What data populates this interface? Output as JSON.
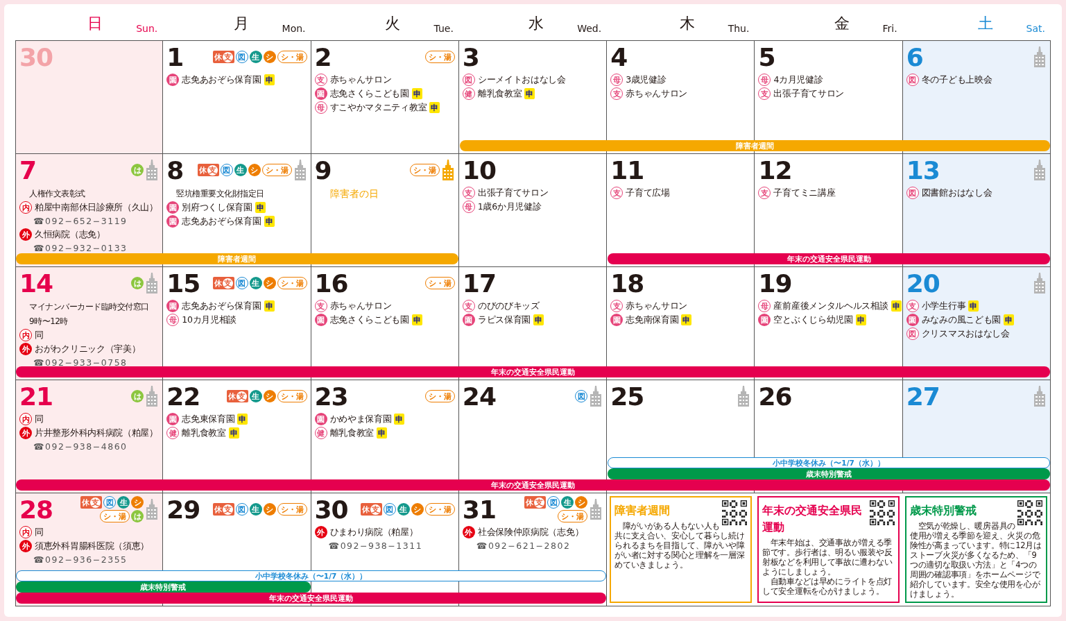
{
  "header": [
    {
      "kanji": "日",
      "en": "Sun.",
      "kind": "sun"
    },
    {
      "kanji": "月",
      "en": "Mon.",
      "kind": "weekday"
    },
    {
      "kanji": "火",
      "en": "Tue.",
      "kind": "weekday"
    },
    {
      "kanji": "水",
      "en": "Wed.",
      "kind": "weekday"
    },
    {
      "kanji": "木",
      "en": "Thu.",
      "kind": "weekday"
    },
    {
      "kanji": "金",
      "en": "Fri.",
      "kind": "weekday"
    },
    {
      "kanji": "土",
      "en": "Sat.",
      "kind": "sat"
    }
  ],
  "weeks": [
    {
      "days": [
        {
          "number": "30",
          "kind": "other"
        },
        {
          "number": "1",
          "kind": "weekday",
          "badges": [
            {
              "kind": "closed",
              "text": "休",
              "sub": "支"
            },
            {
              "kind": "library",
              "text": "図"
            },
            {
              "kind": "life",
              "text": "生"
            },
            {
              "kind": "shi",
              "text": "シ"
            },
            {
              "kind": "bath",
              "text": "シ・湯"
            }
          ],
          "entries": [
            {
              "kind": "event",
              "mark": {
                "text": "園",
                "kind": "pink_filled"
              },
              "text": "志免あおぞら保育園",
              "tag": "申"
            }
          ]
        },
        {
          "number": "2",
          "kind": "weekday",
          "badges": [
            {
              "kind": "bath",
              "text": "シ・湯"
            }
          ],
          "entries": [
            {
              "kind": "event",
              "mark": {
                "text": "支",
                "kind": "pink_outline"
              },
              "text": "赤ちゃんサロン"
            },
            {
              "kind": "event",
              "mark": {
                "text": "園",
                "kind": "pink_filled"
              },
              "text": "志免さくらこども園",
              "tag": "申"
            },
            {
              "kind": "event",
              "mark": {
                "text": "母",
                "kind": "pink_outline"
              },
              "text": "すこやかマタニティ教室",
              "tag": "申"
            }
          ]
        },
        {
          "number": "3",
          "kind": "weekday",
          "entries": [
            {
              "kind": "event",
              "mark": {
                "text": "図",
                "kind": "pink_outline"
              },
              "text": "シーメイトおはなし会"
            },
            {
              "kind": "event",
              "mark": {
                "text": "健",
                "kind": "pink_outline"
              },
              "text": "離乳食教室",
              "tag": "申"
            }
          ]
        },
        {
          "number": "4",
          "kind": "weekday",
          "entries": [
            {
              "kind": "event",
              "mark": {
                "text": "母",
                "kind": "pink_outline"
              },
              "text": "3歳児健診"
            },
            {
              "kind": "event",
              "mark": {
                "text": "支",
                "kind": "pink_outline"
              },
              "text": "赤ちゃんサロン"
            }
          ]
        },
        {
          "number": "5",
          "kind": "weekday",
          "entries": [
            {
              "kind": "event",
              "mark": {
                "text": "母",
                "kind": "pink_outline"
              },
              "text": "4カ月児健診"
            },
            {
              "kind": "event",
              "mark": {
                "text": "支",
                "kind": "pink_outline"
              },
              "text": "出張子育てサロン"
            }
          ]
        },
        {
          "number": "6",
          "kind": "sat",
          "tower": {
            "kind": "plain"
          },
          "entries": [
            {
              "kind": "event",
              "mark": {
                "text": "図",
                "kind": "pink_outline"
              },
              "text": "冬の子ども上映会"
            }
          ]
        }
      ],
      "bands": [
        {
          "slots": [
            {
              "kind": "none"
            },
            {
              "kind": "none"
            },
            {
              "kind": "none"
            },
            {
              "kind": "week",
              "label": "障害者週間"
            },
            {
              "kind": "week"
            },
            {
              "kind": "week"
            },
            {
              "kind": "week"
            }
          ]
        }
      ]
    },
    {
      "days": [
        {
          "number": "7",
          "kind": "sun",
          "tower": {
            "kind": "plain"
          },
          "badges": [
            {
              "kind": "ha",
              "text": "は"
            }
          ],
          "entries": [
            {
              "kind": "plain",
              "text": "人権作文表彰式"
            },
            {
              "kind": "event",
              "mark": {
                "text": "内",
                "kind": "red_outline"
              },
              "text": "粕屋中南部休日診療所（久山）"
            },
            {
              "kind": "phone",
              "text": "☎092−652−3119"
            },
            {
              "kind": "event",
              "mark": {
                "text": "外",
                "kind": "red_filled"
              },
              "text": "久恒病院（志免）"
            },
            {
              "kind": "phone",
              "text": "☎092−932−0133"
            }
          ]
        },
        {
          "number": "8",
          "kind": "weekday",
          "tower": {
            "kind": "plain"
          },
          "badges": [
            {
              "kind": "closed",
              "text": "休",
              "sub": "支"
            },
            {
              "kind": "library",
              "text": "図"
            },
            {
              "kind": "life",
              "text": "生"
            },
            {
              "kind": "shi",
              "text": "シ"
            },
            {
              "kind": "bath",
              "text": "シ・湯"
            }
          ],
          "entries": [
            {
              "kind": "plain",
              "text": "竪坑櫓重要文化財指定日"
            },
            {
              "kind": "event",
              "mark": {
                "text": "園",
                "kind": "pink_filled"
              },
              "text": "別府つくし保育園",
              "tag": "申"
            },
            {
              "kind": "event",
              "mark": {
                "text": "園",
                "kind": "pink_filled"
              },
              "text": "志免あおぞら保育園",
              "tag": "申"
            }
          ]
        },
        {
          "number": "9",
          "kind": "weekday",
          "tower": {
            "kind": "lit"
          },
          "badges": [
            {
              "kind": "bath",
              "text": "シ・湯"
            }
          ],
          "entries": [
            {
              "kind": "notice",
              "text": "障害者の日"
            }
          ]
        },
        {
          "number": "10",
          "kind": "weekday",
          "entries": [
            {
              "kind": "event",
              "mark": {
                "text": "支",
                "kind": "pink_outline"
              },
              "text": "出張子育てサロン"
            },
            {
              "kind": "event",
              "mark": {
                "text": "母",
                "kind": "pink_outline"
              },
              "text": "1歳6か月児健診"
            }
          ]
        },
        {
          "number": "11",
          "kind": "weekday",
          "entries": [
            {
              "kind": "event",
              "mark": {
                "text": "支",
                "kind": "pink_outline"
              },
              "text": "子育て広場"
            }
          ]
        },
        {
          "number": "12",
          "kind": "weekday",
          "entries": [
            {
              "kind": "event",
              "mark": {
                "text": "支",
                "kind": "pink_outline"
              },
              "text": "子育てミニ講座"
            }
          ]
        },
        {
          "number": "13",
          "kind": "sat",
          "tower": {
            "kind": "plain"
          },
          "entries": [
            {
              "kind": "event",
              "mark": {
                "text": "図",
                "kind": "pink_outline"
              },
              "text": "図書館おはなし会"
            }
          ]
        }
      ],
      "bands": [
        {
          "slots": [
            {
              "kind": "week",
              "label": "障害者週間"
            },
            {
              "kind": "week"
            },
            {
              "kind": "week"
            },
            {
              "kind": "none"
            },
            {
              "kind": "traffic",
              "label": "年末の交通安全県民運動"
            },
            {
              "kind": "traffic"
            },
            {
              "kind": "traffic"
            }
          ]
        }
      ]
    },
    {
      "days": [
        {
          "number": "14",
          "kind": "sun",
          "tower": {
            "kind": "plain"
          },
          "badges": [
            {
              "kind": "ha",
              "text": "は"
            }
          ],
          "entries": [
            {
              "kind": "plain",
              "text": "マイナンバーカード臨時交付窓口"
            },
            {
              "kind": "plain",
              "text": "9時〜12時"
            },
            {
              "kind": "event",
              "mark": {
                "text": "内",
                "kind": "red_outline"
              },
              "text": "同"
            },
            {
              "kind": "event",
              "mark": {
                "text": "外",
                "kind": "red_filled"
              },
              "text": "おがわクリニック（宇美）"
            },
            {
              "kind": "phone",
              "text": "☎092−933−0758"
            }
          ]
        },
        {
          "number": "15",
          "kind": "weekday",
          "badges": [
            {
              "kind": "closed",
              "text": "休",
              "sub": "支"
            },
            {
              "kind": "library",
              "text": "図"
            },
            {
              "kind": "life",
              "text": "生"
            },
            {
              "kind": "shi",
              "text": "シ"
            },
            {
              "kind": "bath",
              "text": "シ・湯"
            }
          ],
          "entries": [
            {
              "kind": "event",
              "mark": {
                "text": "園",
                "kind": "pink_filled"
              },
              "text": "志免あおぞら保育園",
              "tag": "申"
            },
            {
              "kind": "event",
              "mark": {
                "text": "母",
                "kind": "pink_outline"
              },
              "text": "10カ月児相談"
            }
          ]
        },
        {
          "number": "16",
          "kind": "weekday",
          "badges": [
            {
              "kind": "bath",
              "text": "シ・湯"
            }
          ],
          "entries": [
            {
              "kind": "event",
              "mark": {
                "text": "支",
                "kind": "pink_outline"
              },
              "text": "赤ちゃんサロン"
            },
            {
              "kind": "event",
              "mark": {
                "text": "園",
                "kind": "pink_filled"
              },
              "text": "志免さくらこども園",
              "tag": "申"
            }
          ]
        },
        {
          "number": "17",
          "kind": "weekday",
          "entries": [
            {
              "kind": "event",
              "mark": {
                "text": "支",
                "kind": "pink_outline"
              },
              "text": "のびのびキッズ"
            },
            {
              "kind": "event",
              "mark": {
                "text": "園",
                "kind": "pink_filled"
              },
              "text": "ラピス保育園",
              "tag": "申"
            }
          ]
        },
        {
          "number": "18",
          "kind": "weekday",
          "entries": [
            {
              "kind": "event",
              "mark": {
                "text": "支",
                "kind": "pink_outline"
              },
              "text": "赤ちゃんサロン"
            },
            {
              "kind": "event",
              "mark": {
                "text": "園",
                "kind": "pink_filled"
              },
              "text": "志免南保育園",
              "tag": "申"
            }
          ]
        },
        {
          "number": "19",
          "kind": "weekday",
          "entries": [
            {
              "kind": "event",
              "mark": {
                "text": "母",
                "kind": "pink_outline"
              },
              "text": "産前産後メンタルヘルス相談",
              "tag": "申"
            },
            {
              "kind": "event",
              "mark": {
                "text": "園",
                "kind": "pink_filled"
              },
              "text": "空とぶくじら幼児園",
              "tag": "申"
            }
          ]
        },
        {
          "number": "20",
          "kind": "sat",
          "tower": {
            "kind": "plain"
          },
          "entries": [
            {
              "kind": "event",
              "mark": {
                "text": "支",
                "kind": "pink_outline"
              },
              "text": "小学生行事",
              "tag": "申"
            },
            {
              "kind": "event",
              "mark": {
                "text": "園",
                "kind": "pink_filled"
              },
              "text": "みなみの風こども園",
              "tag": "申"
            },
            {
              "kind": "event",
              "mark": {
                "text": "図",
                "kind": "pink_outline"
              },
              "text": "クリスマスおはなし会"
            }
          ]
        }
      ],
      "bands": [
        {
          "slots": [
            {
              "kind": "traffic",
              "label": "年末の交通安全県民運動"
            },
            {
              "kind": "traffic"
            },
            {
              "kind": "traffic"
            },
            {
              "kind": "traffic"
            },
            {
              "kind": "traffic"
            },
            {
              "kind": "traffic"
            },
            {
              "kind": "traffic"
            }
          ]
        }
      ]
    },
    {
      "days": [
        {
          "number": "21",
          "kind": "sun",
          "tower": {
            "kind": "plain"
          },
          "badges": [
            {
              "kind": "ha",
              "text": "は"
            }
          ],
          "entries": [
            {
              "kind": "event",
              "mark": {
                "text": "内",
                "kind": "red_outline"
              },
              "text": "同"
            },
            {
              "kind": "event",
              "mark": {
                "text": "外",
                "kind": "red_filled"
              },
              "text": "片井整形外科内科病院（粕屋）"
            },
            {
              "kind": "phone",
              "text": "☎092−938−4860"
            }
          ]
        },
        {
          "number": "22",
          "kind": "weekday",
          "badges": [
            {
              "kind": "closed",
              "text": "休",
              "sub": "支"
            },
            {
              "kind": "life",
              "text": "生"
            },
            {
              "kind": "shi",
              "text": "シ"
            },
            {
              "kind": "bath",
              "text": "シ・湯"
            }
          ],
          "entries": [
            {
              "kind": "event",
              "mark": {
                "text": "園",
                "kind": "pink_filled"
              },
              "text": "志免東保育園",
              "tag": "申"
            },
            {
              "kind": "event",
              "mark": {
                "text": "健",
                "kind": "pink_outline"
              },
              "text": "離乳食教室",
              "tag": "申"
            }
          ]
        },
        {
          "number": "23",
          "kind": "weekday",
          "badges": [
            {
              "kind": "bath",
              "text": "シ・湯"
            }
          ],
          "entries": [
            {
              "kind": "event",
              "mark": {
                "text": "園",
                "kind": "pink_filled"
              },
              "text": "かめやま保育園",
              "tag": "申"
            },
            {
              "kind": "event",
              "mark": {
                "text": "健",
                "kind": "pink_outline"
              },
              "text": "離乳食教室",
              "tag": "申"
            }
          ]
        },
        {
          "number": "24",
          "kind": "weekday",
          "tower": {
            "kind": "plain"
          },
          "badges": [
            {
              "kind": "library",
              "text": "図"
            }
          ]
        },
        {
          "number": "25",
          "kind": "weekday",
          "tower": {
            "kind": "plain"
          }
        },
        {
          "number": "26",
          "kind": "weekday"
        },
        {
          "number": "27",
          "kind": "sat",
          "tower": {
            "kind": "plain"
          }
        }
      ],
      "bands": [
        {
          "slots": [
            {
              "kind": "none"
            },
            {
              "kind": "none"
            },
            {
              "kind": "none"
            },
            {
              "kind": "none"
            },
            {
              "kind": "school",
              "label": "小中学校冬休み（〜1/7（水））"
            },
            {
              "kind": "school"
            },
            {
              "kind": "school"
            }
          ]
        },
        {
          "slots": [
            {
              "kind": "none"
            },
            {
              "kind": "none"
            },
            {
              "kind": "none"
            },
            {
              "kind": "none"
            },
            {
              "kind": "alert",
              "label": "歳末特別警戒"
            },
            {
              "kind": "alert"
            },
            {
              "kind": "alert"
            }
          ]
        },
        {
          "slots": [
            {
              "kind": "traffic",
              "label": "年末の交通安全県民運動"
            },
            {
              "kind": "traffic"
            },
            {
              "kind": "traffic"
            },
            {
              "kind": "traffic"
            },
            {
              "kind": "traffic"
            },
            {
              "kind": "traffic"
            },
            {
              "kind": "traffic"
            }
          ]
        }
      ]
    },
    {
      "days": [
        {
          "number": "28",
          "kind": "sun",
          "tower": {
            "kind": "plain"
          },
          "badges": [
            {
              "kind": "closed",
              "text": "休",
              "sub": "支"
            },
            {
              "kind": "library",
              "text": "図"
            },
            {
              "kind": "life",
              "text": "生"
            },
            {
              "kind": "shi",
              "text": "シ"
            },
            {
              "kind": "bath",
              "text": "シ・湯"
            },
            {
              "kind": "ha",
              "text": "は"
            }
          ],
          "entries": [
            {
              "kind": "event",
              "mark": {
                "text": "内",
                "kind": "red_outline"
              },
              "text": "同"
            },
            {
              "kind": "event",
              "mark": {
                "text": "外",
                "kind": "red_filled"
              },
              "text": "須恵外科胃腸科医院（須恵）"
            },
            {
              "kind": "phone",
              "text": "☎092−936−2355"
            }
          ]
        },
        {
          "number": "29",
          "kind": "weekday",
          "badges": [
            {
              "kind": "closed",
              "text": "休",
              "sub": "支"
            },
            {
              "kind": "library",
              "text": "図"
            },
            {
              "kind": "life",
              "text": "生"
            },
            {
              "kind": "shi",
              "text": "シ"
            },
            {
              "kind": "bath",
              "text": "シ・湯"
            }
          ]
        },
        {
          "number": "30",
          "kind": "weekday",
          "badges": [
            {
              "kind": "closed",
              "text": "休",
              "sub": "支"
            },
            {
              "kind": "library",
              "text": "図"
            },
            {
              "kind": "life",
              "text": "生"
            },
            {
              "kind": "shi",
              "text": "シ"
            },
            {
              "kind": "bath",
              "text": "シ・湯"
            }
          ],
          "entries": [
            {
              "kind": "event",
              "mark": {
                "text": "外",
                "kind": "red_filled"
              },
              "text": "ひまわり病院（粕屋）"
            },
            {
              "kind": "phone",
              "text": "☎092−938−1311"
            }
          ]
        },
        {
          "number": "31",
          "kind": "weekday",
          "tower": {
            "kind": "plain"
          },
          "badges": [
            {
              "kind": "closed",
              "text": "休",
              "sub": "支"
            },
            {
              "kind": "library",
              "text": "図"
            },
            {
              "kind": "life",
              "text": "生"
            },
            {
              "kind": "shi",
              "text": "シ"
            },
            {
              "kind": "bath",
              "text": "シ・湯"
            }
          ],
          "entries": [
            {
              "kind": "event",
              "mark": {
                "text": "外",
                "kind": "red_filled"
              },
              "text": "社会保険仲原病院（志免）"
            },
            {
              "kind": "phone",
              "text": "☎092−621−2802"
            }
          ]
        }
      ],
      "bands": [
        {
          "slots": [
            {
              "kind": "school",
              "label": "小中学校冬休み（〜1/7（水））"
            },
            {
              "kind": "school"
            },
            {
              "kind": "school"
            },
            {
              "kind": "school"
            },
            {
              "kind": "none"
            },
            {
              "kind": "none"
            },
            {
              "kind": "none"
            }
          ]
        },
        {
          "slots": [
            {
              "kind": "alert",
              "label": "歳末特別警戒"
            },
            {
              "kind": "alert"
            },
            {
              "kind": "none"
            },
            {
              "kind": "none"
            },
            {
              "kind": "none"
            },
            {
              "kind": "none"
            },
            {
              "kind": "none"
            }
          ]
        },
        {
          "slots": [
            {
              "kind": "traffic",
              "label": "年末の交通安全県民運動"
            },
            {
              "kind": "traffic"
            },
            {
              "kind": "traffic"
            },
            {
              "kind": "traffic"
            },
            {
              "kind": "none"
            },
            {
              "kind": "none"
            },
            {
              "kind": "none"
            }
          ]
        }
      ],
      "notices": [
        {
          "kind": "orange",
          "title": "障害者週間",
          "paragraphs": [
            "障がいがある人もない人も共に支え合い、安心して暮らし続けられるまちを目指して、障がいや障がい者に対する関心と理解を一層深めていきましょう。"
          ]
        },
        {
          "kind": "red",
          "title": "年末の交通安全県民運動",
          "paragraphs": [
            "年末年始は、交通事故が増える季節です。歩行者は、明るい服装や反射板などを利用して事故に遭わないようにしましょう。",
            "自動車などは早めにライトを点灯して安全運転を心がけましょう。"
          ]
        },
        {
          "kind": "green",
          "title": "歳末特別警戒",
          "paragraphs": [
            "空気が乾燥し、暖房器具の使用が増える季節を迎え、火災の危険性が高まっています。特に12月はストーブ火災が多くなるため、「9つの適切な取扱い方法」と「4つの周囲の確認事項」をホームページで紹介しています。安全な使用を心がけましょう。"
          ]
        }
      ]
    }
  ]
}
